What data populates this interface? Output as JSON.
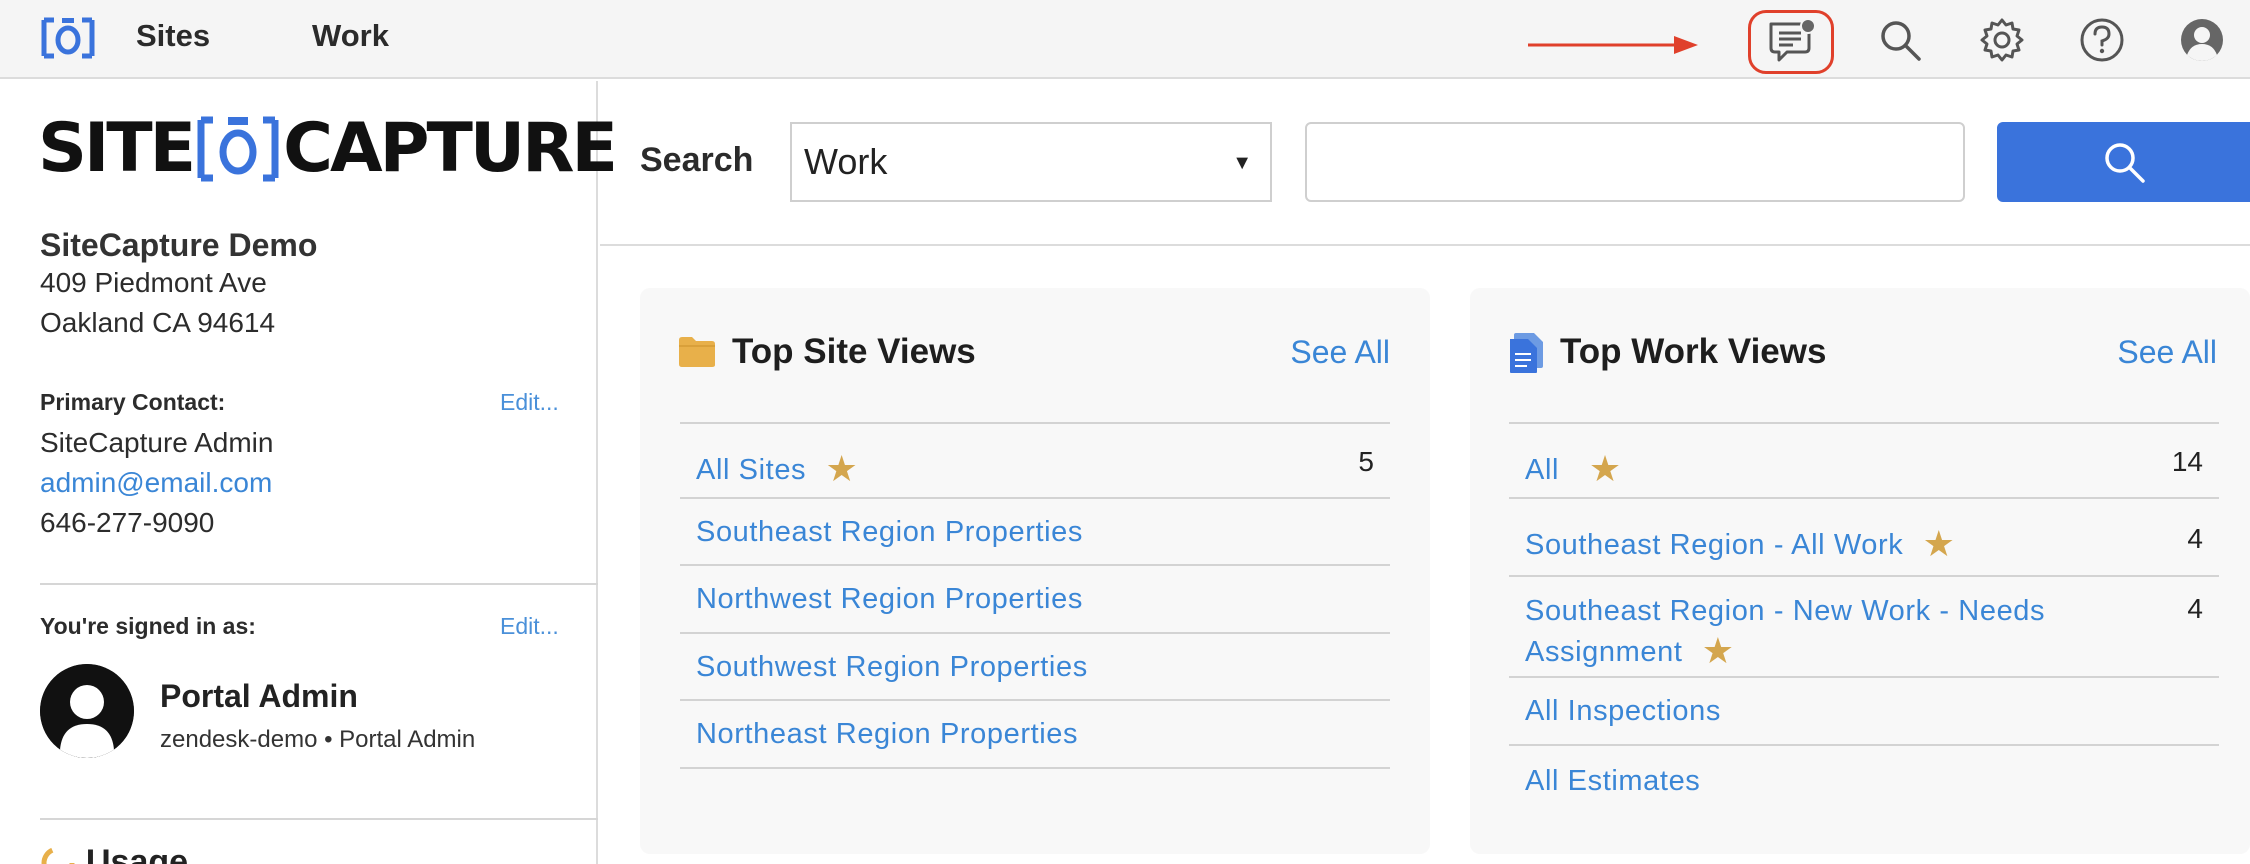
{
  "nav": {
    "sites": "Sites",
    "work": "Work"
  },
  "brand": {
    "left": "SITE",
    "right": "CAPTURE"
  },
  "company": {
    "name": "SiteCapture Demo",
    "address_line1": "409 Piedmont Ave",
    "address_line2": "Oakland CA 94614"
  },
  "primary_contact": {
    "label": "Primary Contact:",
    "edit": "Edit...",
    "name": "SiteCapture Admin",
    "email": "admin@email.com",
    "phone": "646-277-9090"
  },
  "signed_in": {
    "label": "You're signed in as:",
    "edit": "Edit...",
    "user_name": "Portal Admin",
    "user_sub": "zendesk-demo • Portal Admin"
  },
  "usage": {
    "label": "Usage"
  },
  "search": {
    "label": "Search",
    "select_value": "Work",
    "input_value": ""
  },
  "top_site_views": {
    "title": "Top Site Views",
    "see_all": "See All",
    "rows": [
      {
        "label": "All Sites",
        "starred": true,
        "count": "5"
      },
      {
        "label": "Southeast Region Properties",
        "starred": false,
        "count": ""
      },
      {
        "label": "Northwest Region Properties",
        "starred": false,
        "count": ""
      },
      {
        "label": "Southwest Region Properties",
        "starred": false,
        "count": ""
      },
      {
        "label": "Northeast Region Properties",
        "starred": false,
        "count": ""
      }
    ]
  },
  "top_work_views": {
    "title": "Top Work Views",
    "see_all": "See All",
    "rows": [
      {
        "label": "All",
        "starred": true,
        "count": "14"
      },
      {
        "label": "Southeast Region - All Work",
        "starred": true,
        "count": "4"
      },
      {
        "label_line1": "Southeast Region - New Work - Needs",
        "label_line2": "Assignment",
        "starred": true,
        "count": "4"
      },
      {
        "label": "All Inspections",
        "starred": false,
        "count": ""
      },
      {
        "label": "All Estimates",
        "starred": false,
        "count": ""
      }
    ]
  },
  "colors": {
    "accent": "#3a73dc",
    "link": "#3a86d6",
    "star": "#d4a64e",
    "highlight": "#e0402b",
    "folder": "#e8b04a",
    "doc": "#3a73dc"
  },
  "icons": {
    "logo": "sitecapture-logo-icon",
    "chat": "chat-notification-icon",
    "search": "search-icon",
    "settings": "gear-icon",
    "help": "help-icon",
    "account": "user-icon",
    "folder": "folder-icon",
    "document": "document-icon",
    "star": "star-icon"
  }
}
